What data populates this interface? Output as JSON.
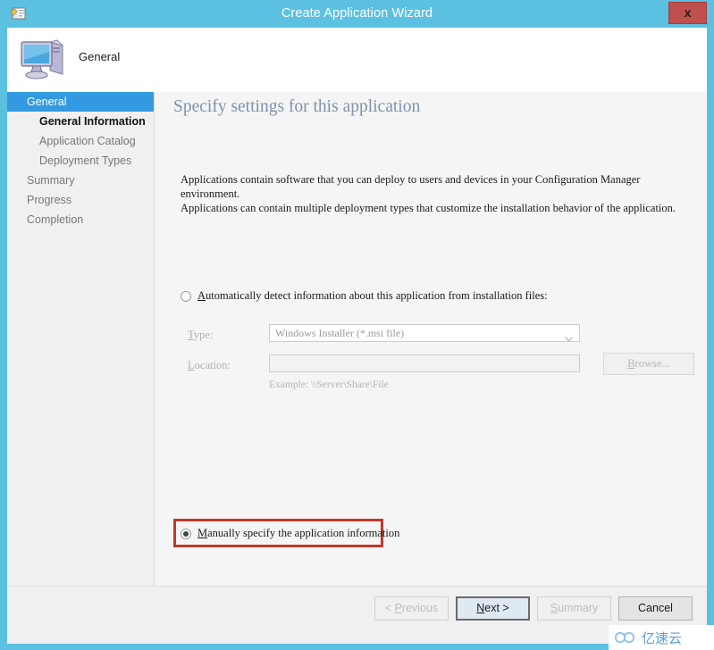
{
  "window": {
    "title": "Create Application Wizard",
    "title_icon": "application-wizard-icon",
    "close_label": "x",
    "accent_color": "#5cc0e0",
    "close_color": "#c0504d"
  },
  "header": {
    "icon": "computer-monitor-icon",
    "label": "General"
  },
  "sidebar": {
    "items": [
      {
        "label": "General",
        "state": "selected",
        "indent": false
      },
      {
        "label": "General Information",
        "state": "current",
        "indent": true
      },
      {
        "label": "Application Catalog",
        "state": "normal",
        "indent": true
      },
      {
        "label": "Deployment Types",
        "state": "normal",
        "indent": true
      },
      {
        "label": "Summary",
        "state": "normal",
        "indent": false
      },
      {
        "label": "Progress",
        "state": "normal",
        "indent": false
      },
      {
        "label": "Completion",
        "state": "normal",
        "indent": false
      }
    ],
    "selected_color": "#3399e0"
  },
  "content": {
    "heading": "Specify settings for this application",
    "heading_color": "#7d93ab",
    "description_line1": "Applications contain software that you can deploy to users and devices in your Configuration Manager environment.",
    "description_line2": "Applications can contain multiple deployment types that customize the installation behavior of the application.",
    "option_auto": {
      "accel": "A",
      "rest": "utomatically detect information about this application from installation files:",
      "checked": false,
      "enabled": true
    },
    "option_manual": {
      "accel": "M",
      "rest": "anually specify the application information",
      "checked": true,
      "enabled": true,
      "highlight_color": "#c0392b"
    },
    "type_field": {
      "accel": "T",
      "label_rest": "ype:",
      "value": "Windows Installer (*.msi file)",
      "enabled": false
    },
    "location_field": {
      "accel": "L",
      "label_rest": "ocation:",
      "value": "",
      "enabled": false
    },
    "example_text": "Example: \\\\Server\\Share\\File",
    "browse_button": {
      "accel": "B",
      "rest": "rowse...",
      "enabled": false
    }
  },
  "footer": {
    "buttons": [
      {
        "name": "previous",
        "accel": "P",
        "before": "< ",
        "rest": "revious",
        "state": "disabled"
      },
      {
        "name": "next",
        "accel": "N",
        "before": "",
        "rest": "ext >",
        "state": "default"
      },
      {
        "name": "summary",
        "accel": "S",
        "before": "",
        "rest": "ummary",
        "state": "disabled"
      },
      {
        "name": "cancel",
        "accel": "",
        "before": "Cancel",
        "rest": "",
        "state": "enabled"
      }
    ]
  },
  "watermark": {
    "text": "亿速云",
    "color": "#5b9bd5"
  }
}
